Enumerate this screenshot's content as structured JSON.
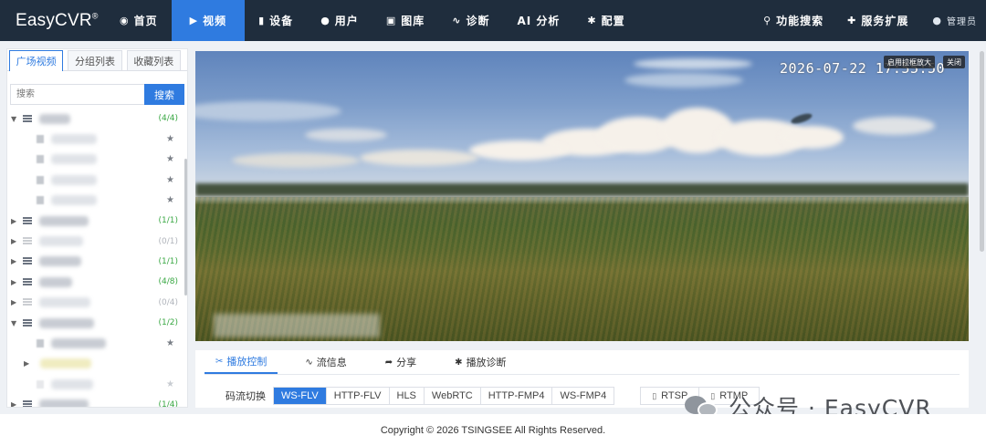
{
  "app": {
    "name": "EasyCVR",
    "reg": "®"
  },
  "nav": {
    "items": [
      {
        "label": "首页",
        "icon": "dashboard-icon",
        "active": false
      },
      {
        "label": "视频",
        "icon": "play-circle-icon",
        "active": true
      },
      {
        "label": "设备",
        "icon": "device-icon",
        "active": false
      },
      {
        "label": "用户",
        "icon": "user-icon",
        "active": false
      },
      {
        "label": "图库",
        "icon": "gallery-icon",
        "active": false
      },
      {
        "label": "诊断",
        "icon": "pulse-icon",
        "active": false
      },
      {
        "label": "AI 分析",
        "icon": "",
        "active": false
      },
      {
        "label": "配置",
        "icon": "gear-icon",
        "active": false
      }
    ],
    "right": [
      {
        "label": "功能搜索",
        "icon": "search-icon"
      },
      {
        "label": "服务扩展",
        "icon": "puzzle-icon"
      }
    ],
    "user": "管理员"
  },
  "left": {
    "tabs": [
      "广场视频",
      "分组列表",
      "收藏列表"
    ],
    "search_placeholder": "搜索",
    "search_button": "搜索",
    "tree_counts": [
      "(4/4)",
      "(1/1)",
      "(0/1)",
      "(1/1)",
      "(4/8)",
      "(0/4)",
      "(1/2)",
      "(1/4)"
    ]
  },
  "video": {
    "timestamp": "2026-07-22 17:55:50",
    "zoom_button": "启用拉框放大",
    "close_button": "关闭"
  },
  "controls": {
    "tabs": [
      "播放控制",
      "流信息",
      "分享",
      "播放诊断"
    ],
    "stream_label": "码流切换",
    "formats": [
      "WS-FLV",
      "HTTP-FLV",
      "HLS",
      "WebRTC",
      "HTTP-FMP4",
      "WS-FMP4"
    ],
    "active_format": "WS-FLV",
    "protocols": [
      "RTSP",
      "RTMP"
    ]
  },
  "watermark": "公众号 · EasyCVR",
  "footer": "Copyright © 2026 TSINGSEE All Rights Reserved."
}
